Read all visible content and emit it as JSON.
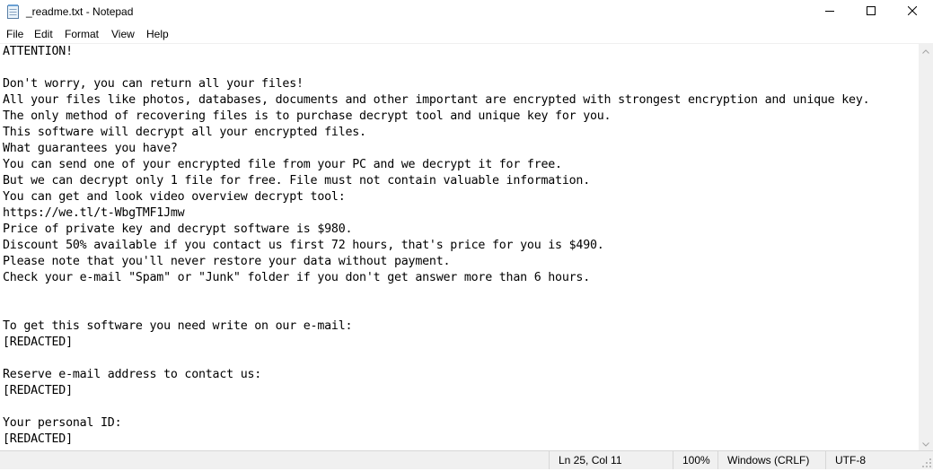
{
  "window": {
    "title": "_readme.txt - Notepad",
    "icon": "notepad-icon",
    "controls": [
      "minimize-icon",
      "maximize-icon",
      "close-icon"
    ]
  },
  "menu": {
    "file": "File",
    "edit": "Edit",
    "format": "Format",
    "view": "View",
    "help": "Help"
  },
  "editor": {
    "content": "ATTENTION!\n\nDon't worry, you can return all your files!\nAll your files like photos, databases, documents and other important are encrypted with strongest encryption and unique key.\nThe only method of recovering files is to purchase decrypt tool and unique key for you.\nThis software will decrypt all your encrypted files.\nWhat guarantees you have?\nYou can send one of your encrypted file from your PC and we decrypt it for free.\nBut we can decrypt only 1 file for free. File must not contain valuable information.\nYou can get and look video overview decrypt tool:\nhttps://we.tl/t-WbgTMF1Jmw\nPrice of private key and decrypt software is $980.\nDiscount 50% available if you contact us first 72 hours, that's price for you is $490.\nPlease note that you'll never restore your data without payment.\nCheck your e-mail \"Spam\" or \"Junk\" folder if you don't get answer more than 6 hours.\n\n\nTo get this software you need write on our e-mail:\n[REDACTED]\n\nReserve e-mail address to contact us:\n[REDACTED]\n\nYour personal ID:\n[REDACTED]"
  },
  "status": {
    "position": "Ln 25, Col 11",
    "zoom": "100%",
    "line_endings": "Windows (CRLF)",
    "encoding": "UTF-8"
  }
}
